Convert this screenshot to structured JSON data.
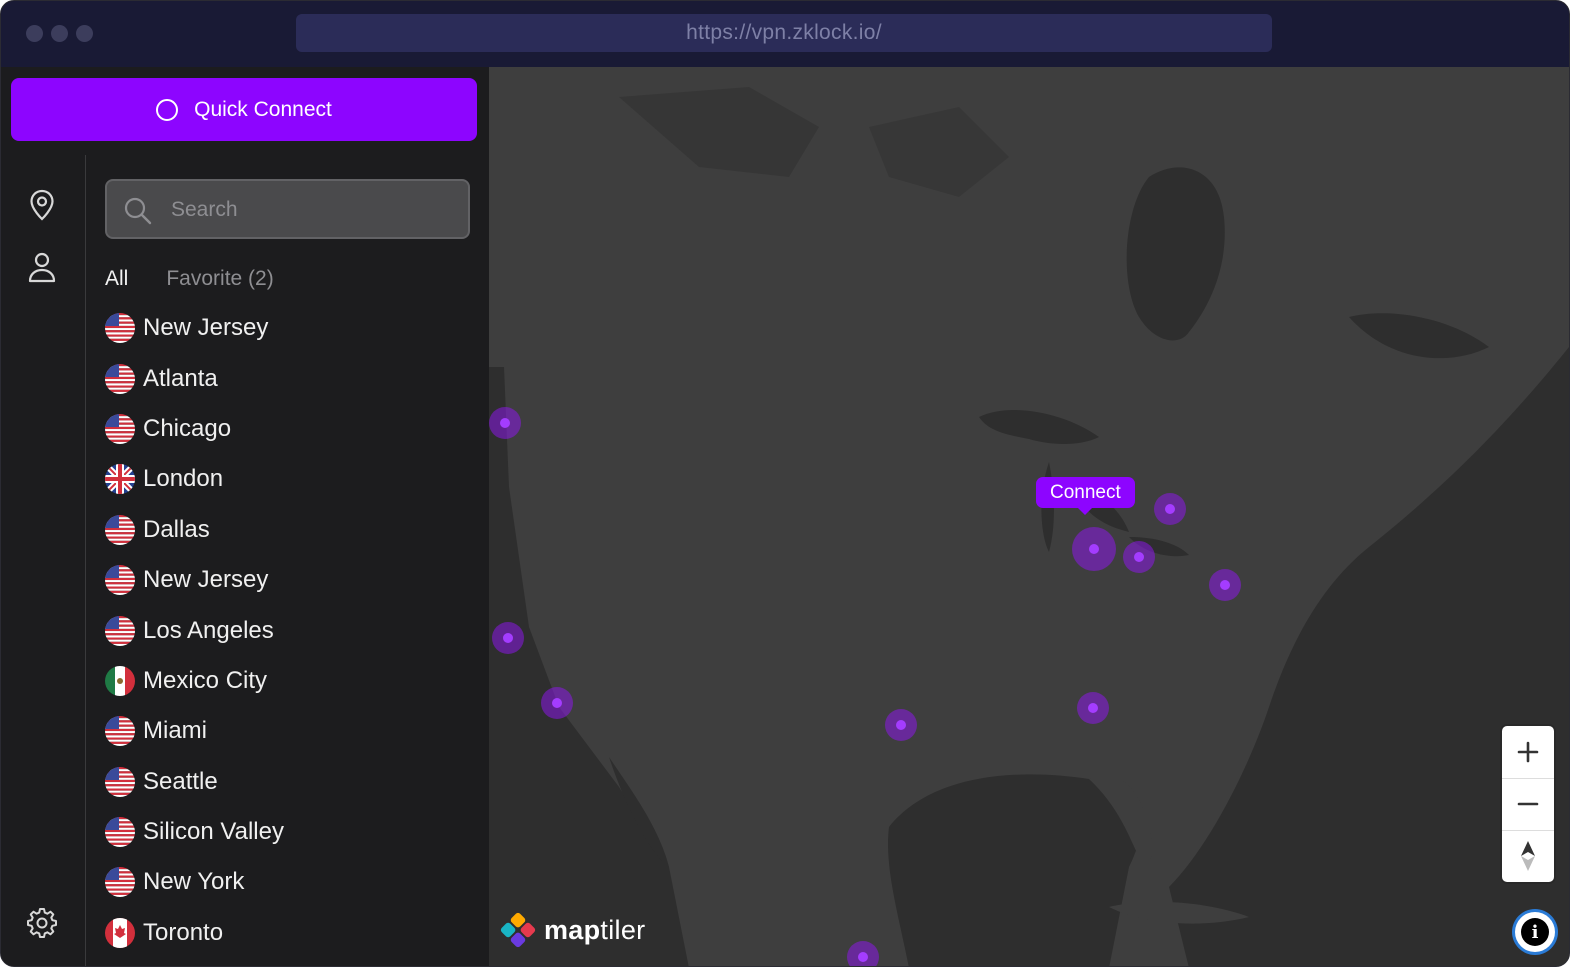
{
  "browser": {
    "url": "https://vpn.zklock.io/"
  },
  "sidebar": {
    "quick_connect_label": "Quick Connect",
    "rail_icons": [
      "location-pin-icon",
      "user-icon",
      "gear-icon"
    ],
    "search": {
      "placeholder": "Search",
      "value": ""
    },
    "tabs": [
      {
        "label": "All",
        "active": true
      },
      {
        "label": "Favorite (2)",
        "active": false
      }
    ],
    "locations": [
      {
        "name": "New Jersey",
        "flag": "us"
      },
      {
        "name": "Atlanta",
        "flag": "us"
      },
      {
        "name": "Chicago",
        "flag": "us"
      },
      {
        "name": "London",
        "flag": "gb"
      },
      {
        "name": "Dallas",
        "flag": "us"
      },
      {
        "name": "New Jersey",
        "flag": "us"
      },
      {
        "name": "Los Angeles",
        "flag": "us"
      },
      {
        "name": "Mexico City",
        "flag": "mx"
      },
      {
        "name": "Miami",
        "flag": "us"
      },
      {
        "name": "Seattle",
        "flag": "us"
      },
      {
        "name": "Silicon Valley",
        "flag": "us"
      },
      {
        "name": "New York",
        "flag": "us"
      },
      {
        "name": "Toronto",
        "flag": "ca"
      }
    ]
  },
  "map": {
    "tooltip_label": "Connect",
    "attribution": {
      "logo_bold": "map",
      "logo_light": "tiler"
    },
    "controls": [
      "zoom-in-icon",
      "zoom-out-icon",
      "compass-icon"
    ],
    "info_label": "i"
  },
  "colors": {
    "accent": "#8d05ff",
    "titlebar": "#191a35",
    "sidebar_bg": "#1c1c1e",
    "map_land": "#3e3e3e",
    "map_water": "#2e2e2e"
  }
}
